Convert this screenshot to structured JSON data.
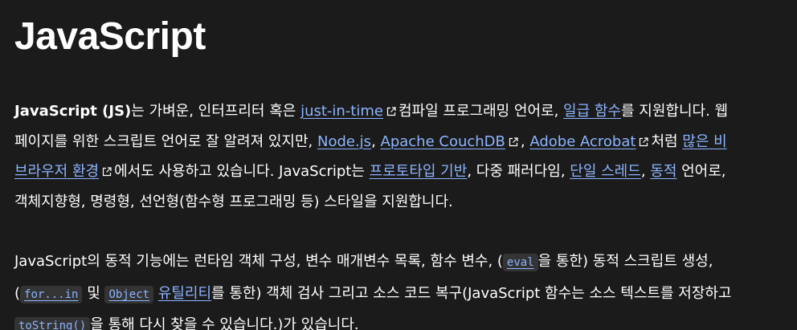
{
  "title": "JavaScript",
  "p1": {
    "js_strong": "JavaScript (JS)",
    "t1": "는 가벼운, 인터프리터 혹은 ",
    "link_jit": "just-in-time",
    "t2": "컴파일 프로그래밍 언어로, ",
    "link_firstclass": "일급 함수",
    "t3": "를 지원합니다. 웹 페이지를 위한 스크립트 언어로 잘 알려져 있지만, ",
    "link_node": "Node.js",
    "t4": ", ",
    "link_couch": "Apache CouchDB",
    "t5": ", ",
    "link_acrobat": "Adobe Acrobat",
    "t6": "처럼 ",
    "link_nonbrowser": "많은 비 브라우저 환경",
    "t7": "에서도 사용하고 있습니다. JavaScript는 ",
    "link_prototype": "프로토타입 기반",
    "t8": ", 다중 패러다임, ",
    "link_single_thread": "단일 스레드",
    "t9": ", ",
    "link_dynamic": "동적",
    "t10": " 언어로, 객체지향형, 명령형, 선언형(함수형 프로그래밍 등) 스타일을 지원합니다."
  },
  "p2": {
    "t1": "JavaScript의 동적 기능에는 런타임 객체 구성, 변수 매개변수 목록, 함수 변수, (",
    "code_eval": "eval",
    "t2": "을 통한) 동적 스크립트 생성, (",
    "code_forin": "for...in",
    "t3": " 및 ",
    "code_object": "Object",
    "link_utilities": "유틸리티",
    "t4": "를 통한) 객체 검사 그리고 소스 코드 복구(JavaScript 함수는 소스 텍스트를 저장하고 ",
    "code_tostring": "toString()",
    "t5": "을 통해 다시 찾을 수 있습니다.)가 있습니다."
  },
  "colors": {
    "background": "#1b1b1b",
    "text": "#ffffff",
    "link": "#8cb4ff",
    "code_background": "#343434"
  },
  "icons": {
    "external_link": "external-link-icon"
  }
}
